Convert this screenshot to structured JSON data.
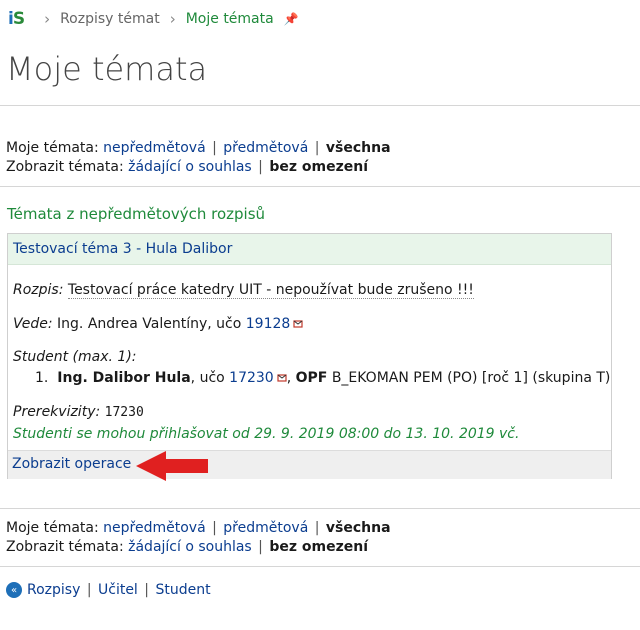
{
  "breadcrumb": {
    "logo": "iS",
    "items": [
      "Rozpisy témat",
      "Moje témata"
    ],
    "pin_icon": "pin-icon"
  },
  "page_title": "Moje témata",
  "filters": {
    "my_topics_label": "Moje témata:",
    "my_topics_options": [
      "nepředmětová",
      "předmětová",
      "všechna"
    ],
    "show_topics_label": "Zobrazit témata:",
    "show_topics_options": [
      "žádající o souhlas",
      "bez omezení"
    ]
  },
  "section_title": "Témata z nepředmětových rozpisů",
  "topic": {
    "header": "Testovací téma 3 - Hula Dalibor",
    "rozpis_label": "Rozpis:",
    "rozpis_value": "Testovací práce katedry UIT - nepoužívat bude zrušeno !!!",
    "vede_label": "Vede:",
    "vede_name": "Ing. Andrea Valentíny, učo",
    "vede_uco": "19128",
    "student_label": "Student (max. 1):",
    "student_num": "1.",
    "student_name": "Ing. Dalibor Hula",
    "student_uco_prefix": ", učo",
    "student_uco": "17230",
    "student_faculty": "OPF",
    "student_program": "B_EKOMAN PEM (PO) [roč 1] (skupina T)",
    "prereq_label": "Prerekvizity:",
    "prereq_value": "17230",
    "signup_note": "Studenti se mohou přihlašovat od 29. 9. 2019 08:00 do 13. 10. 2019 vč.",
    "operations_link": "Zobrazit operace"
  },
  "bottom_nav": [
    "Rozpisy",
    "Učitel",
    "Student"
  ],
  "colors": {
    "link": "#0b3d8f",
    "green": "#1f8a3b",
    "header_bg": "#e8f5ea",
    "arrow": "#e02020"
  }
}
